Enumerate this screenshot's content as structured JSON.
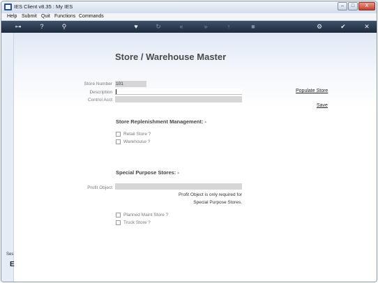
{
  "window": {
    "title": "IES Client v8.35 : My IES",
    "controls": {
      "minimize": "–",
      "maximize": "□",
      "close": "X"
    }
  },
  "menu": [
    {
      "label": "Help"
    },
    {
      "label": "Submit"
    },
    {
      "label": "Quit"
    },
    {
      "label": "Functions"
    },
    {
      "label": "Commands"
    }
  ],
  "toolbar": {
    "icons": [
      {
        "name": "key-icon",
        "glyph": "⊶"
      },
      {
        "name": "help-icon",
        "glyph": "?"
      },
      {
        "name": "search-icon",
        "glyph": "⚲"
      },
      {
        "name": "heart-icon",
        "glyph": "♥"
      },
      {
        "name": "refresh-icon",
        "glyph": "↻"
      },
      {
        "name": "rewind-icon",
        "glyph": "«"
      },
      {
        "name": "forward-icon",
        "glyph": "»"
      },
      {
        "name": "upload-icon",
        "glyph": "↑"
      },
      {
        "name": "stop-icon",
        "glyph": "■"
      },
      {
        "name": "settings-icon",
        "glyph": "⚙"
      },
      {
        "name": "ok-icon",
        "glyph": "✔"
      },
      {
        "name": "close-icon",
        "glyph": "✕"
      }
    ]
  },
  "sidebar": {
    "text": "Ses",
    "big_letter": "E"
  },
  "page": {
    "title": "Store / Warehouse Master",
    "fields": {
      "store_number": {
        "label": "Store Number",
        "value": "101"
      },
      "description": {
        "label": "Description",
        "value": ""
      },
      "control_acct": {
        "label": "Control Acct",
        "value": ""
      }
    },
    "links": {
      "populate": "Populate Store",
      "save": "Save"
    },
    "replenishment": {
      "heading": "Store Replenishment Management: -",
      "options": [
        {
          "label": "Retail Store ?",
          "checked": false
        },
        {
          "label": "Warehouse ?",
          "checked": false
        }
      ]
    },
    "special": {
      "heading": "Special Purpose Stores: -",
      "profit_object": {
        "label": "Profit Object",
        "value": ""
      },
      "note_line1": "Profit Object is only required for",
      "note_line2": "Special Purpose Stores.",
      "options": [
        {
          "label": "Planned Maint Store ?",
          "checked": false
        },
        {
          "label": "Truck Store ?",
          "checked": false
        }
      ]
    }
  },
  "colors": {
    "toolbar_bg": "#2a3a50",
    "field_grey": "#d6d6d6",
    "title_text": "#4a4a4a"
  }
}
